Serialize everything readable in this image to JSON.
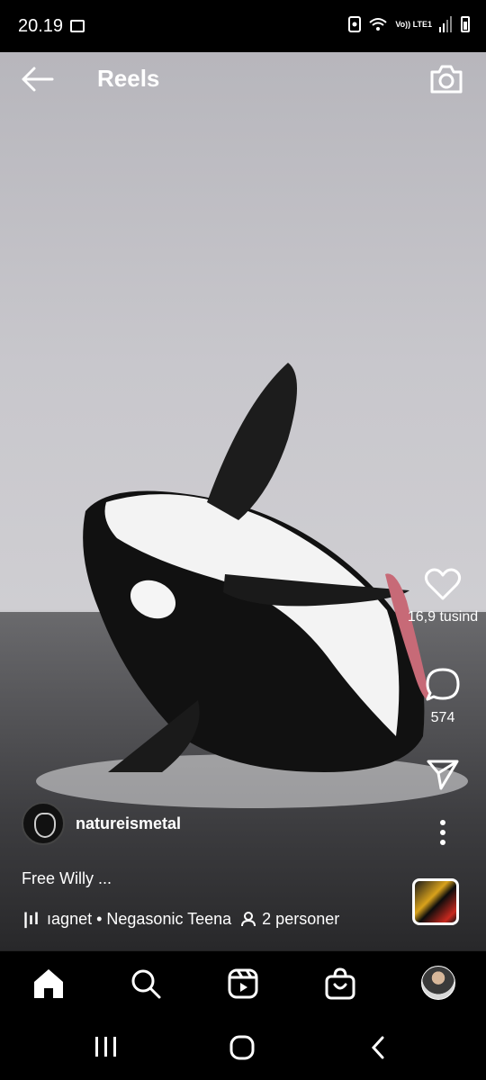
{
  "status_bar": {
    "time": "20.19",
    "network": "Vo)) LTE1"
  },
  "header": {
    "title": "Reels"
  },
  "actions": {
    "likes": "16,9 tusind",
    "comments": "574"
  },
  "post": {
    "username": "natureismetal",
    "caption": "Free Willy ...",
    "music": "ıagnet • Negasonic Teena",
    "collaborators": "2 personer"
  },
  "icons": {
    "back": "back-arrow-icon",
    "camera": "camera-icon",
    "like": "heart-icon",
    "comment": "comment-icon",
    "share": "send-icon",
    "more": "more-vertical-icon",
    "home": "home-icon",
    "search": "search-icon",
    "reels": "reels-icon",
    "shop": "shop-icon"
  }
}
